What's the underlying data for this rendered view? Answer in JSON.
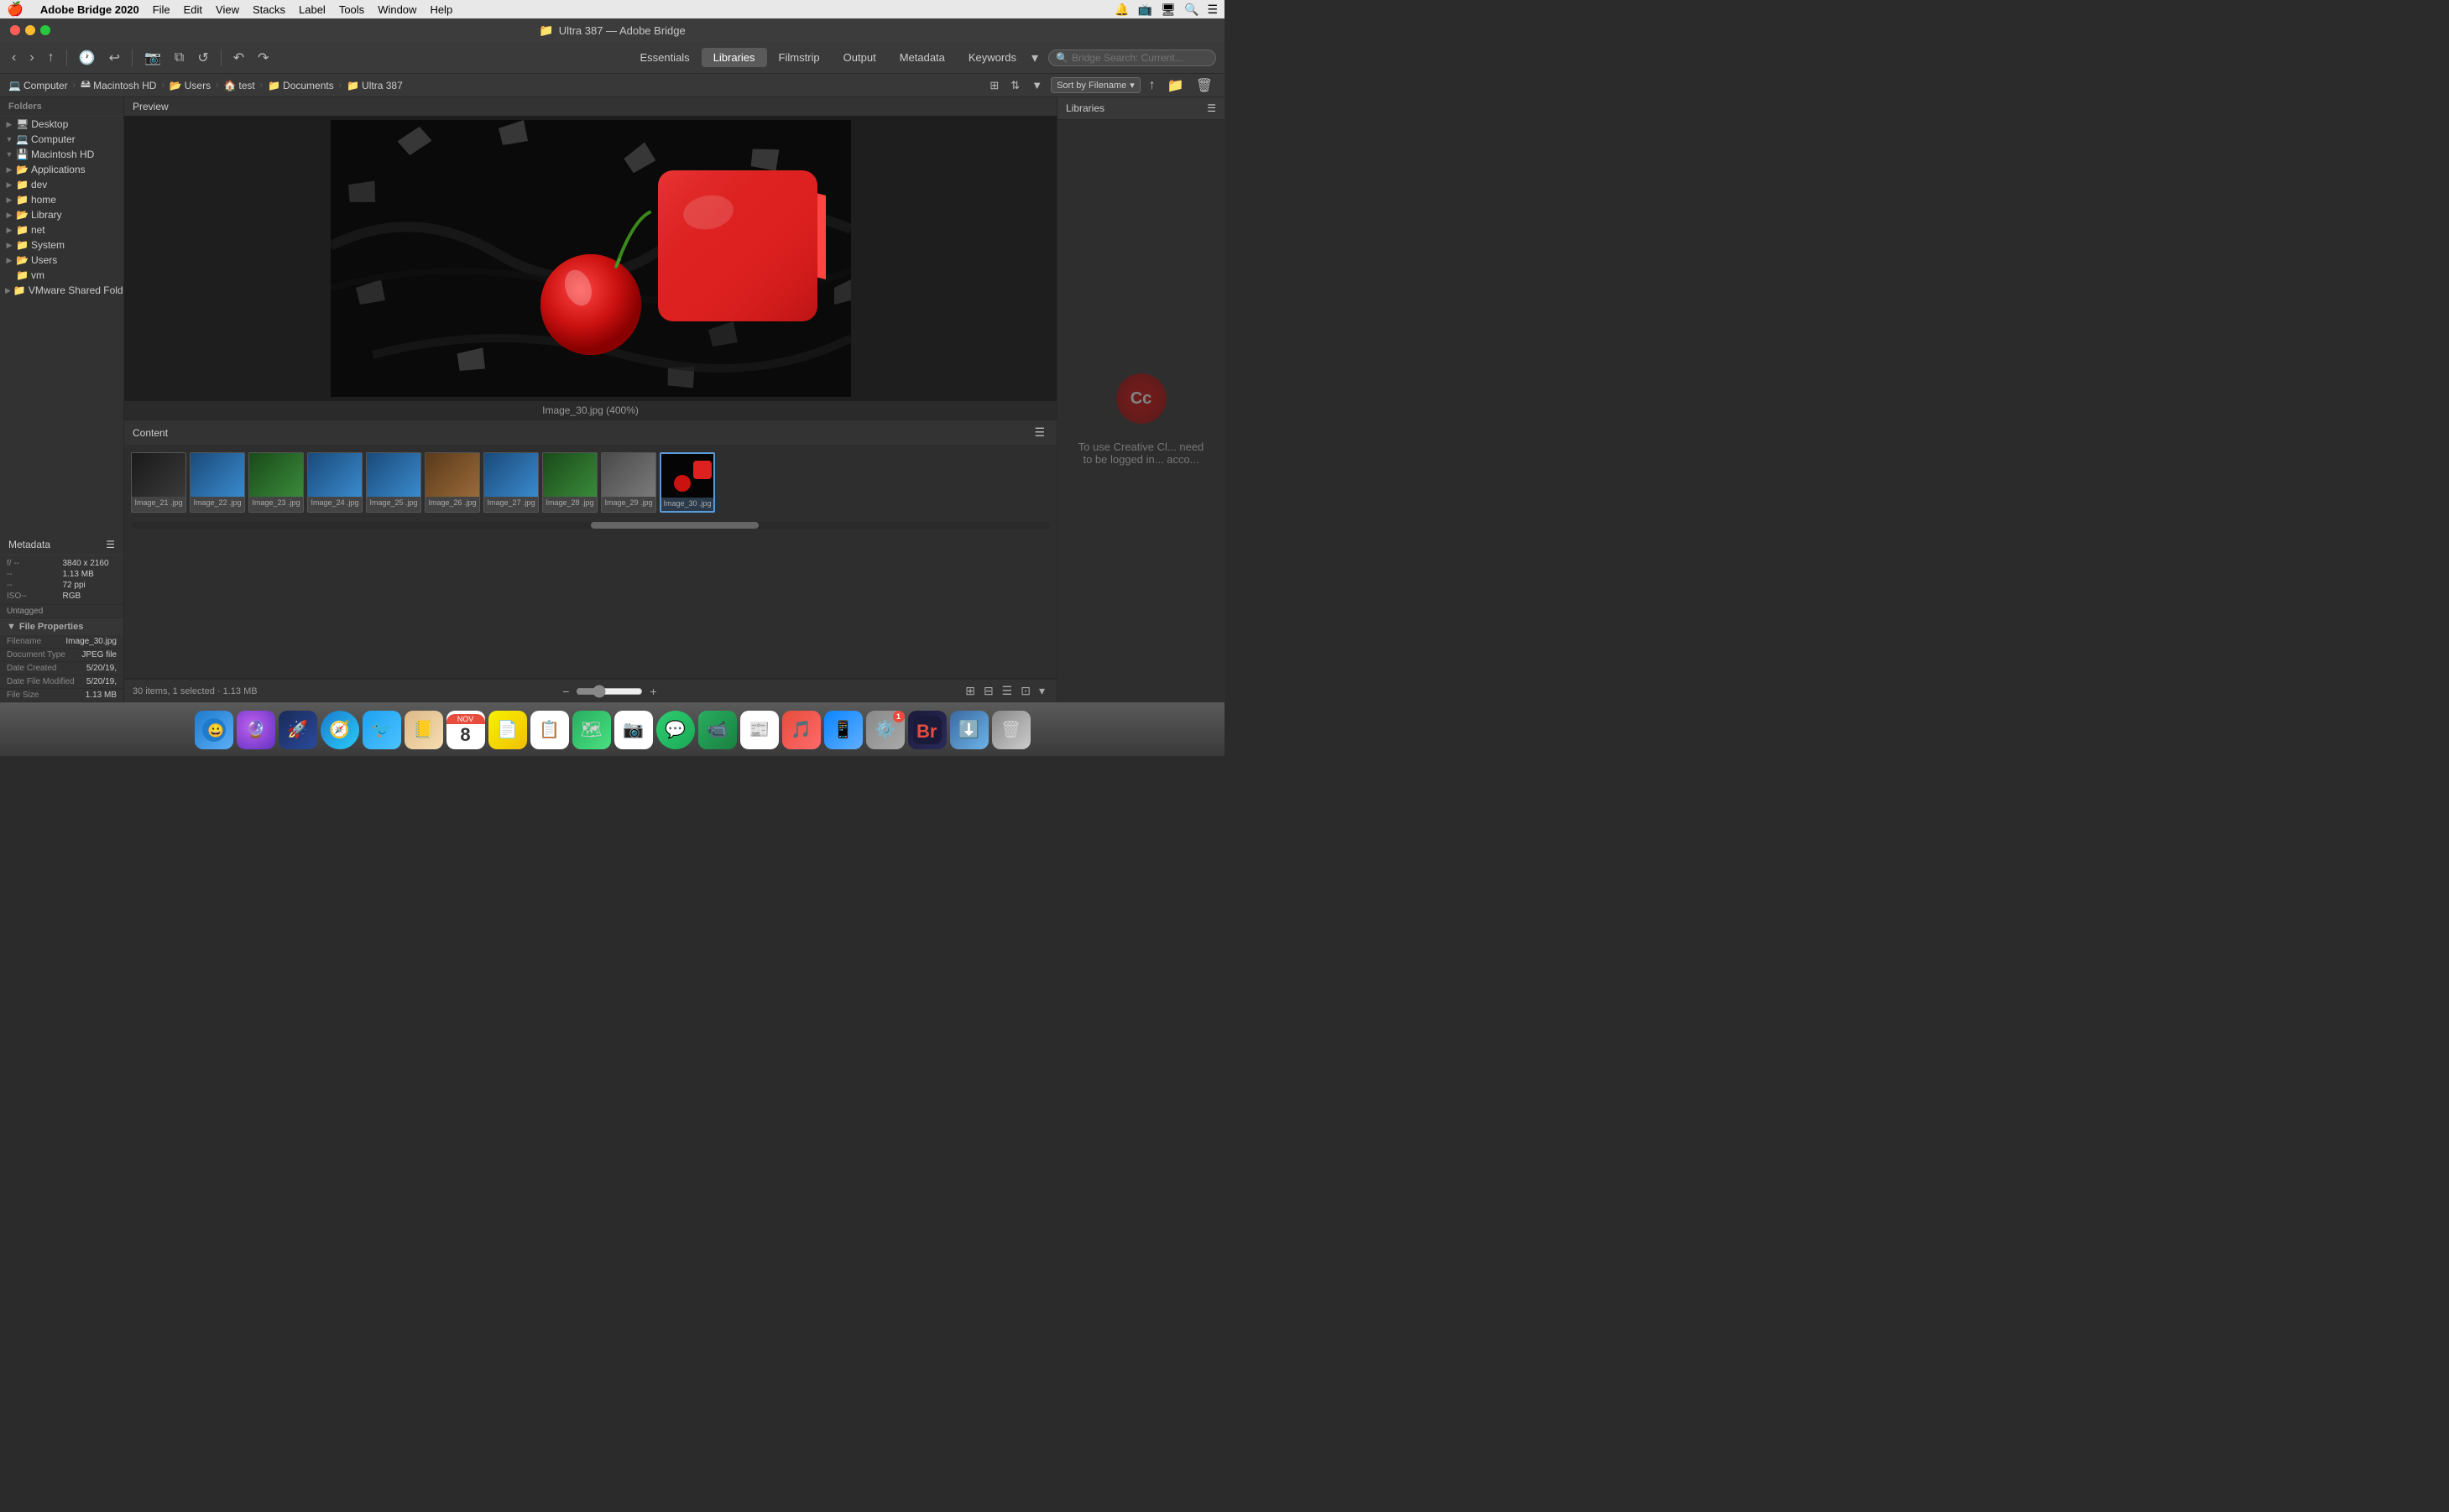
{
  "menubar": {
    "apple": "🍎",
    "items": [
      "Adobe Bridge 2020",
      "File",
      "Edit",
      "View",
      "Stacks",
      "Label",
      "Tools",
      "Window",
      "Help"
    ]
  },
  "titlebar": {
    "folder_icon": "📁",
    "title": "Ultra 387 — Adobe Bridge"
  },
  "toolbar": {
    "back": "‹",
    "forward": "›",
    "nav_tabs": [
      "Essentials",
      "Libraries",
      "Filmstrip",
      "Output",
      "Metadata",
      "Keywords"
    ]
  },
  "breadcrumb": {
    "items": [
      "Computer",
      "Macintosh HD",
      "Users",
      "test",
      "Documents",
      "Ultra 387"
    ]
  },
  "sort": {
    "label": "Sort by Filename"
  },
  "sidebar": {
    "header": "Folders",
    "items": [
      {
        "label": "Desktop",
        "icon": "🖥",
        "indent": 0,
        "arrow": "▶"
      },
      {
        "label": "Computer",
        "icon": "💻",
        "indent": 0,
        "arrow": "▼",
        "expanded": true
      },
      {
        "label": "Macintosh HD",
        "icon": "🖴",
        "indent": 1,
        "arrow": "▼",
        "expanded": true
      },
      {
        "label": "Applications",
        "icon": "📂",
        "indent": 2,
        "arrow": "▶"
      },
      {
        "label": "dev",
        "icon": "📁",
        "indent": 2,
        "arrow": "▶"
      },
      {
        "label": "home",
        "icon": "📁",
        "indent": 2,
        "arrow": "▶"
      },
      {
        "label": "Library",
        "icon": "📂",
        "indent": 2,
        "arrow": "▶"
      },
      {
        "label": "net",
        "icon": "📁",
        "indent": 2,
        "arrow": "▶"
      },
      {
        "label": "System",
        "icon": "📁",
        "indent": 2,
        "arrow": "▶"
      },
      {
        "label": "Users",
        "icon": "📂",
        "indent": 2,
        "arrow": "▶"
      },
      {
        "label": "vm",
        "icon": "📁",
        "indent": 3,
        "arrow": ""
      },
      {
        "label": "VMware Shared Folders",
        "icon": "📁",
        "indent": 0,
        "arrow": "▶"
      }
    ]
  },
  "preview": {
    "label": "Preview",
    "filename": "Image_30.jpg (400%)"
  },
  "content": {
    "label": "Content",
    "thumbnails": [
      {
        "label": "Image_21\n.jpg",
        "color": "thumb-dark"
      },
      {
        "label": "Image_22\n.jpg",
        "color": "thumb-blue"
      },
      {
        "label": "Image_23\n.jpg",
        "color": "thumb-green"
      },
      {
        "label": "Image_24\n.jpg",
        "color": "thumb-blue"
      },
      {
        "label": "Image_25\n.jpg",
        "color": "thumb-blue"
      },
      {
        "label": "Image_26\n.jpg",
        "color": "thumb-brown"
      },
      {
        "label": "Image_27\n.jpg",
        "color": "thumb-blue"
      },
      {
        "label": "Image_28\n.jpg",
        "color": "thumb-green"
      },
      {
        "label": "Image_29\n.jpg",
        "color": "thumb-gray"
      },
      {
        "label": "Image_30\n.jpg",
        "color": "thumb-black",
        "selected": true
      }
    ]
  },
  "status_bar": {
    "info": "30 items, 1 selected · 1.13 MB",
    "zoom_minus": "−",
    "zoom_plus": "+"
  },
  "metadata": {
    "header": "Metadata",
    "camera_fields": [
      {
        "key": "f/",
        "val": "--"
      },
      {
        "key": "--",
        "val": ""
      },
      {
        "key": "--",
        "val": ""
      },
      {
        "key": "ISO--",
        "val": ""
      }
    ],
    "dimensions": "3840 x 2160",
    "size": "1.13 MB",
    "ppi": "72 ppi",
    "untagged": "Untagged",
    "rgb": "RGB",
    "file_properties_header": "File Properties",
    "rows": [
      {
        "key": "Filename",
        "val": "Image_30.jpg"
      },
      {
        "key": "Document Type",
        "val": "JPEG file"
      },
      {
        "key": "Date Created",
        "val": "5/20/19,"
      },
      {
        "key": "Date File Modified",
        "val": "5/20/19,"
      },
      {
        "key": "File Size",
        "val": "1.13 MB"
      }
    ]
  },
  "libraries": {
    "header": "Libraries",
    "message": "To use Creative Cl... need to be logged in... acco..."
  },
  "dock": {
    "items": [
      {
        "icon": "🔵",
        "label": "Finder",
        "color": "#1e7bcd"
      },
      {
        "icon": "🔮",
        "label": "Siri",
        "color": "#9b59b6"
      },
      {
        "icon": "🚀",
        "label": "Rocket",
        "color": "#2980b9"
      },
      {
        "icon": "🧭",
        "label": "Safari",
        "color": "#2980b9"
      },
      {
        "icon": "🐦",
        "label": "Tweetbot",
        "color": "#1da1f2"
      },
      {
        "icon": "📒",
        "label": "Contacts",
        "color": "#e67e22"
      },
      {
        "icon": "📅",
        "label": "Calendar",
        "color": "#e74c3c"
      },
      {
        "icon": "📄",
        "label": "Notes",
        "color": "#f1c40f"
      },
      {
        "icon": "📋",
        "label": "Reminders",
        "color": "#e74c3c"
      },
      {
        "icon": "🗺",
        "label": "Maps",
        "color": "#27ae60"
      },
      {
        "icon": "📷",
        "label": "Photos",
        "color": "#e74c3c"
      },
      {
        "icon": "💬",
        "label": "Messages",
        "color": "#2ecc71"
      },
      {
        "icon": "🤝",
        "label": "Facetime",
        "color": "#27ae60"
      },
      {
        "icon": "📰",
        "label": "News",
        "color": "#e74c3c"
      },
      {
        "icon": "🎵",
        "label": "Music",
        "color": "#e74c3c"
      },
      {
        "icon": "📱",
        "label": "AppStore",
        "color": "#2980b9"
      },
      {
        "icon": "⚙️",
        "label": "SystemPrefs",
        "color": "#888"
      },
      {
        "icon": "🅱️",
        "label": "Bridge",
        "color": "#e74c3c"
      },
      {
        "icon": "⬇️",
        "label": "Downloads",
        "color": "#6db3e8"
      },
      {
        "icon": "🗑",
        "label": "Trash",
        "color": "#888"
      }
    ]
  }
}
